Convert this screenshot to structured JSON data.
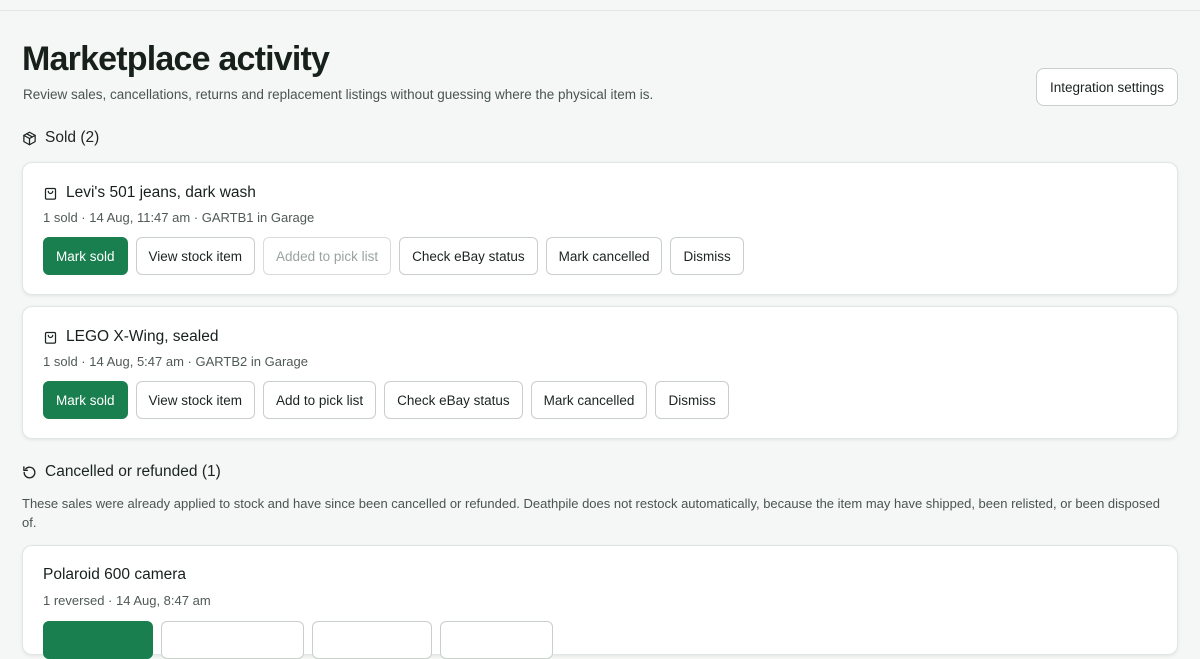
{
  "header": {
    "title": "Marketplace activity",
    "subtitle": "Review sales, cancellations, returns and replacement listings without guessing where the physical item is.",
    "settings_label": "Integration settings"
  },
  "sold_section": {
    "heading": "Sold (2)",
    "cards": [
      {
        "title": "Levi's 501 jeans, dark wash",
        "meta": "1 sold · 14 Aug, 11:47 am · GARTB1 in Garage",
        "actions": [
          "Mark sold",
          "View stock item",
          "Added to pick list",
          "Check eBay status",
          "Mark cancelled",
          "Dismiss"
        ]
      },
      {
        "title": "LEGO X-Wing, sealed",
        "meta": "1 sold · 14 Aug, 5:47 am · GARTB2 in Garage",
        "actions": [
          "Mark sold",
          "View stock item",
          "Add to pick list",
          "Check eBay status",
          "Mark cancelled",
          "Dismiss"
        ]
      }
    ]
  },
  "cancelled_section": {
    "heading": "Cancelled or refunded (1)",
    "note": "These sales were already applied to stock and have since been cancelled or refunded. Deathpile does not restock automatically, because the item may have shipped, been relisted, or been disposed of.",
    "cards": [
      {
        "title": "Polaroid 600 camera",
        "meta": "1 reversed · 14 Aug, 8:47 am"
      }
    ]
  },
  "colors": {
    "primary": "#1a7f4e",
    "background": "#f4f7f5"
  },
  "icons": {
    "sold": "box-icon",
    "item": "shopping-bag-icon",
    "cancelled": "rotate-ccw-icon"
  }
}
